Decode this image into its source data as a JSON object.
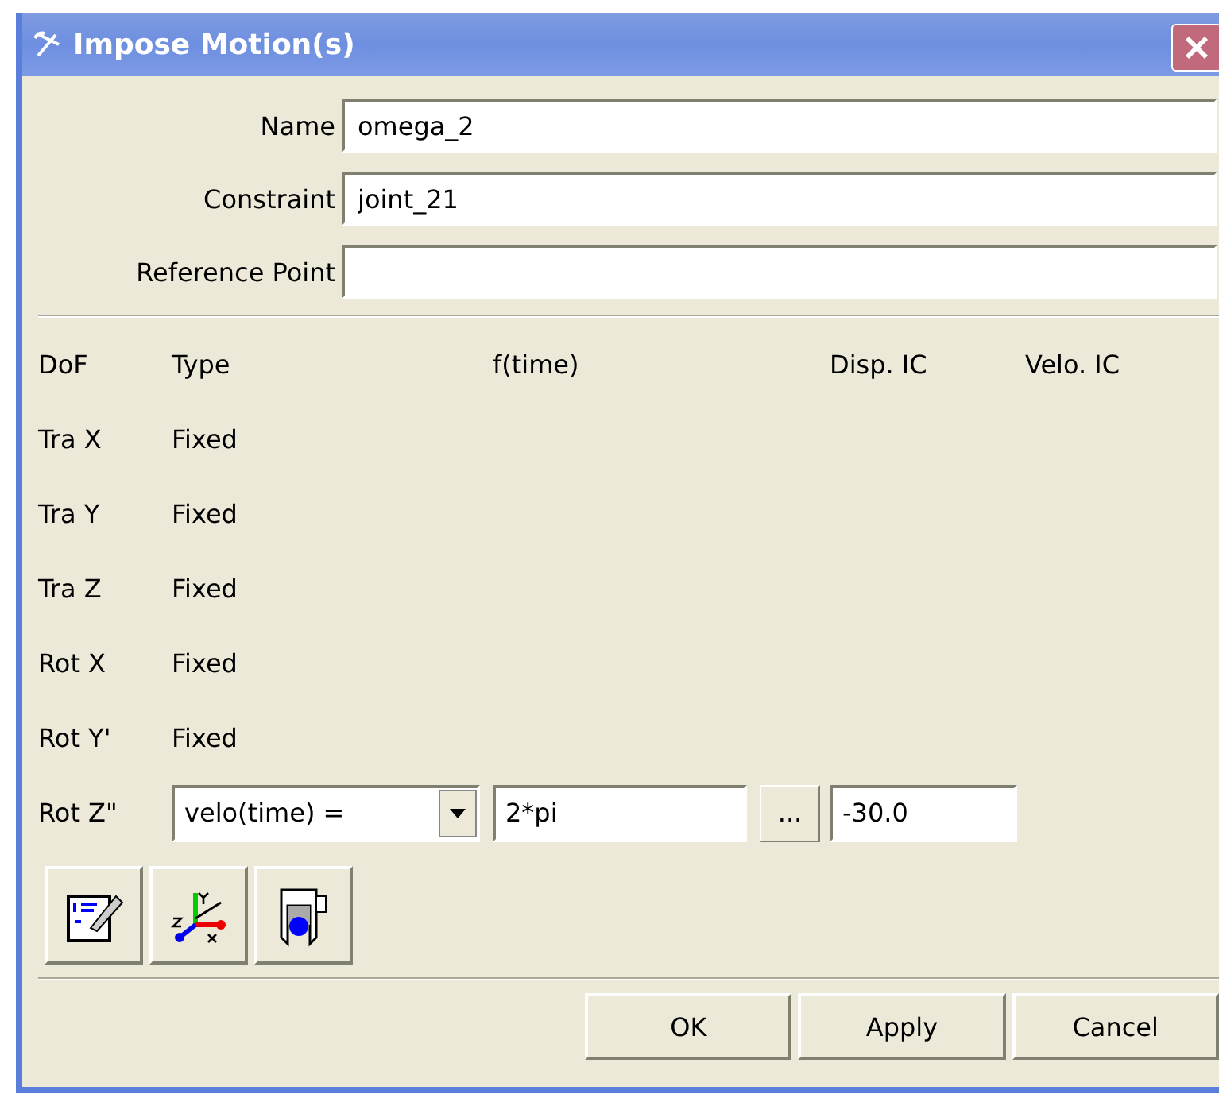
{
  "window": {
    "title": "Impose Motion(s)"
  },
  "fields": [
    {
      "label": "Name",
      "value": "omega_2"
    },
    {
      "label": "Constraint",
      "value": "joint_21"
    },
    {
      "label": "Reference Point"
    }
  ],
  "table": {
    "columns": [
      "DoF",
      "Type",
      "f(time)",
      "Disp. IC",
      "Velo. IC"
    ],
    "rows": [
      {
        "kind": "fixed",
        "dof": "Tra X",
        "type": "Fixed"
      },
      {
        "kind": "fixed",
        "dof": "Tra Y",
        "type": "Fixed"
      },
      {
        "kind": "fixed",
        "dof": "Tra Z",
        "type": "Fixed"
      },
      {
        "kind": "fixed",
        "dof": "Rot X",
        "type": "Fixed"
      },
      {
        "kind": "fixed",
        "dof": "Rot Y'",
        "type": "Fixed"
      },
      {
        "kind": "editor",
        "dof": "Rot Z\"",
        "type": "velo(time) =",
        "f_time": "2*pi",
        "browse": "...",
        "disp_ic": "-30.0"
      }
    ]
  },
  "buttons": [
    "OK",
    "Apply",
    "Cancel"
  ]
}
